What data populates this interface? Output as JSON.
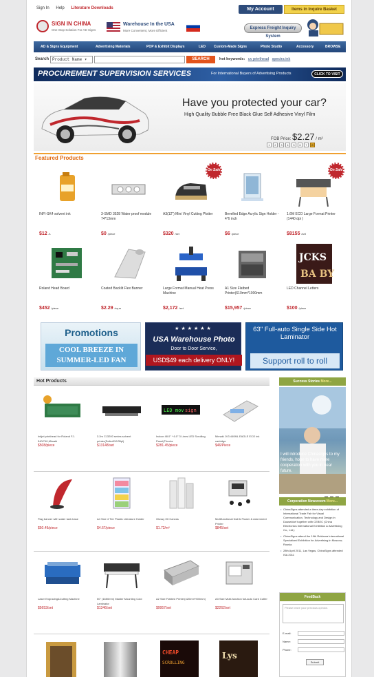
{
  "topbar": {
    "signin": "Sign In",
    "help": "Help",
    "downloads": "Literature Downloads",
    "account": "My Account",
    "basket": "Items in Inquire Basket"
  },
  "header": {
    "logo_title": "SIGN IN CHINA",
    "logo_sub": "One Stop Solution For AD Signs",
    "usa_title": "Warehouse In the USA",
    "usa_sub": "More Convenient, More Efficient",
    "express": "Express Freight Inquiry System"
  },
  "nav": [
    "AD & Signs Equipment",
    "Advertising Materials",
    "POP & Exhibit Displays",
    "LED",
    "Custom-Made Signs",
    "Photo Studio",
    "Accessory",
    "BROWSE"
  ],
  "search": {
    "label": "Search",
    "select": "Product Name",
    "button": "SEARCH",
    "hot_label": "hot keywords:",
    "hot1": "uv printhead",
    "hot2": "spectra ink"
  },
  "procurement": {
    "title": "PROCUREMENT SUPERVISION SERVICES",
    "sub": "For International Buyers of Advertising Products",
    "button": "CLICK TO VISIT"
  },
  "banner": {
    "headline": "Have you protected your car?",
    "subline": "High Quality Bubble Free Black Glue Self Adhesive Vinyl Film",
    "fob_label": "FOB Price:",
    "price": "$2.27",
    "unit": "/ m²",
    "pages": [
      "1",
      "2",
      "3",
      "4",
      "5",
      "6",
      "7",
      "8"
    ],
    "active_page": 8
  },
  "featured": {
    "title": "Featured Products",
    "sale_label": "On Sale",
    "items": [
      {
        "name": "INFI-SK4 solvent ink",
        "price": "$12",
        "unit": "/L"
      },
      {
        "name": "3-SMD 3528 Water proof module 74*13mm",
        "price": "$0",
        "unit": "/piece"
      },
      {
        "name": "A3(12\") Mini Vinyl Cutting Plotter",
        "price": "$320",
        "unit": "/set"
      },
      {
        "name": "Bevelled Edge Acrylic Sign Holder - 4\"6 inch",
        "price": "$6",
        "unit": "/piece"
      },
      {
        "name": "1.6M ECO Large Format Printer (1440 dpi )",
        "price": "$8155",
        "unit": "/set"
      },
      {
        "name": "Roland Head Board",
        "price": "$452",
        "unit": "/piece"
      },
      {
        "name": "Coated Backlit Flex Banner",
        "price": "$2.29",
        "unit": "/sq.m"
      },
      {
        "name": "Large Format Manual Heat Press Machine",
        "price": "$2,172",
        "unit": "/set"
      },
      {
        "name": "A1 Size Flatbed Printer(610mm*1000mm",
        "price": "$15,957",
        "unit": "/piece"
      },
      {
        "name": "LED Channel Letters",
        "price": "$100",
        "unit": "/piece"
      }
    ]
  },
  "promos": {
    "p1_title": "Promotions",
    "p1_sub": "COOL BREEZE IN SUMMER-LED FAN",
    "p2_stars": "★★★★★★",
    "p2_title": "USA Warehouse Photo",
    "p2_sub": "Door to Door Service,",
    "p2_price": "USD$49 each delivery ONLY!",
    "p3_title": "63\" Full-auto Single Side Hot Laminator",
    "p3_sub": "Support roll to roll"
  },
  "hot": {
    "title": "Hot Products",
    "items": [
      {
        "name": "Inkjet printhead for Roland FJ-540/740,Mimaki",
        "price": "$508/piece"
      },
      {
        "name": "3.2m CJ3200 series solvent printer(Seiko510/35pl)",
        "price": "$13148/set"
      },
      {
        "name": "Indoor 48.0\" * 6.0\" 3 Lines LED Scrolling Panel(Tricolor",
        "price": "$281.45/piece"
      },
      {
        "name": "Mimaki JV3 440ML EAGLE ECO ink cartridge",
        "price": "$46/Piece"
      },
      {
        "name": "Flag banner with water tank base",
        "price": "$50.49/piece"
      },
      {
        "name": "A4 Size 4 Tier Plastic Literature Holder",
        "price": "$4.67/piece"
      },
      {
        "name": "Glossy Oil Canvas",
        "price": "$1.72/m²"
      },
      {
        "name": "Multifunctional Nail & Flower & Adornment Printer",
        "price": "$845/set"
      },
      {
        "name": "Laser Engraving&Cutting Machine",
        "price": "$5653/set"
      },
      {
        "name": "50\" (1650mm) Master Mounting Cold Laminator",
        "price": "$1346/set"
      },
      {
        "name": "A2 Size Flatbed Printer(420mm*900mm)",
        "price": "$9957/set"
      },
      {
        "name": "A3 Size Multi-function full-auto Card Cutter",
        "price": "$2262/set"
      }
    ]
  },
  "side": {
    "success_title": "Success Stories",
    "more": "More...",
    "success_caption": "I will introduce Chinasigns to my friends, hope to have more cooperation with you in near future.",
    "pages": [
      "1",
      "2",
      "3"
    ],
    "news_title": "Corporation Newsroom",
    "news": [
      "ChinaSigns attended a three-day exhibition of International Trade Fair for Visual Communication, Technology and Design in Dusseldorf together with CEBEC (China Electronics International Exhibition & Advertising Co., Ltd.)",
      "ChinaSigns attend the 19th Reklama International Specialized Exhibition for Advertising in Moscow, Russia.",
      "28th April 2011, Las Vegas, ChinaSigns attended ISA 2011"
    ],
    "feedback_title": "FeedBack",
    "feedback_placeholder": "Please leave your precious opinion.",
    "email_label": "E-mail:",
    "name_label": "Name:",
    "phone_label": "Phone:",
    "submit": "Submit"
  },
  "colors": {
    "brand_red": "#c0272d",
    "nav_blue": "#2d4b7a",
    "accent_orange": "#e06a10",
    "side_green": "#8fa543"
  }
}
